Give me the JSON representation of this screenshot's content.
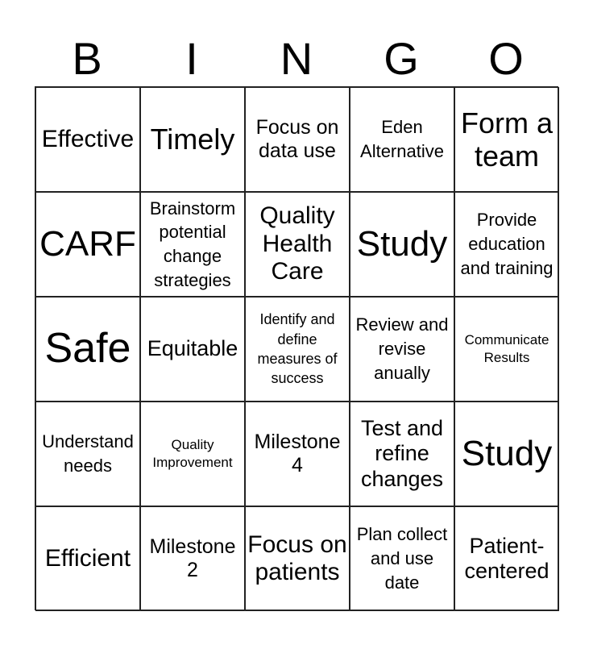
{
  "header": {
    "letters": [
      "B",
      "I",
      "N",
      "G",
      "O"
    ]
  },
  "grid": {
    "rows": [
      [
        "Effective",
        "Timely",
        "Focus on data use",
        "Eden Alternative",
        "Form a team"
      ],
      [
        "CARF",
        "Brainstorm potential change strategies",
        "Quality Health Care",
        "Study",
        "Provide education and training"
      ],
      [
        "Safe",
        "Equitable",
        "Identify and define measures of success",
        "Review and revise anually",
        "Communicate Results"
      ],
      [
        "Understand needs",
        "Quality Improvement",
        "Milestone 4",
        "Test and refine changes",
        "Study"
      ],
      [
        "Efficient",
        "Milestone 2",
        "Focus on patients",
        "Plan collect and use date",
        "Patient-centered"
      ]
    ]
  },
  "colors": {
    "background": "#ffffff",
    "grid_line": "#222222",
    "text": "#000000"
  }
}
